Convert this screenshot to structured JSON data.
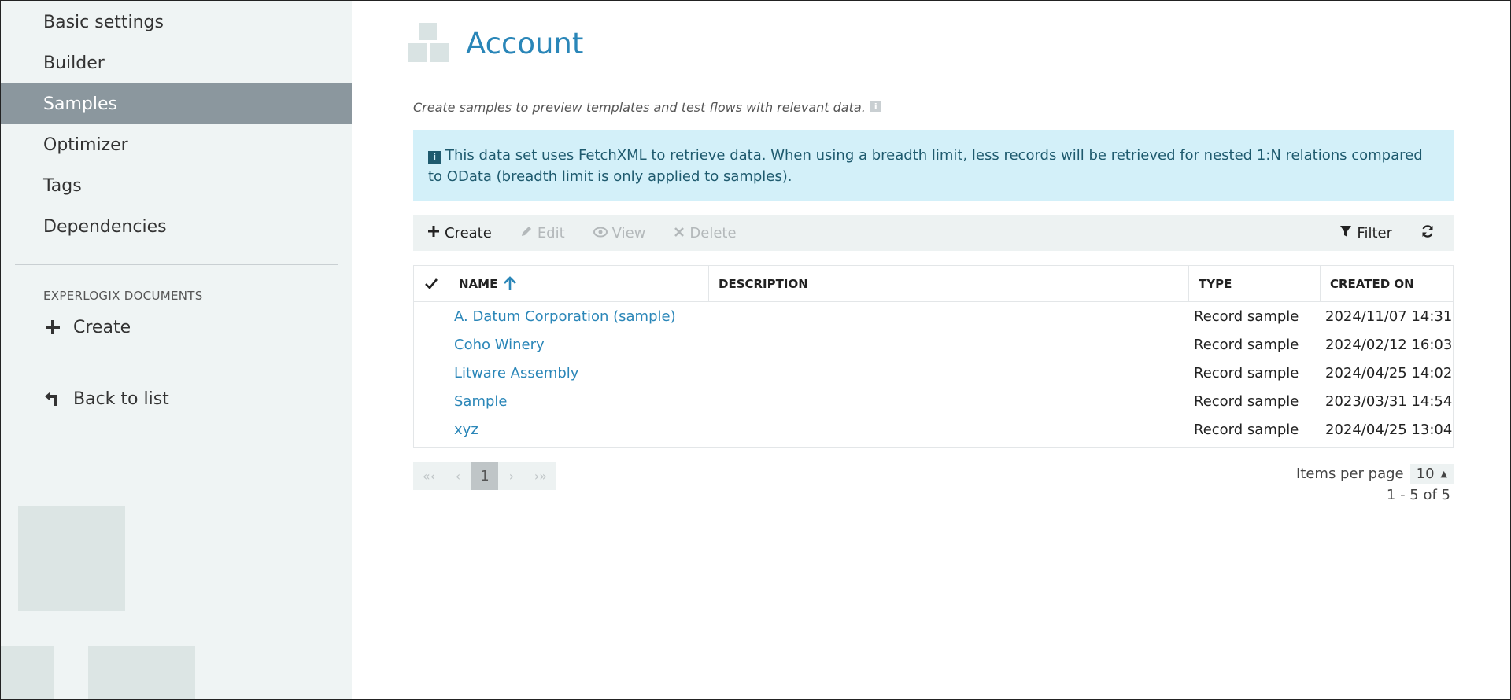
{
  "sidebar": {
    "items": [
      {
        "label": "Basic settings"
      },
      {
        "label": "Builder"
      },
      {
        "label": "Samples"
      },
      {
        "label": "Optimizer"
      },
      {
        "label": "Tags"
      },
      {
        "label": "Dependencies"
      }
    ],
    "section_title": "EXPERLOGIX DOCUMENTS",
    "create_label": "Create",
    "back_label": "Back to list"
  },
  "header": {
    "title": "Account",
    "subtitle": "Create samples to preview templates and test flows with relevant data.",
    "info_glyph": "i"
  },
  "alert": {
    "icon_glyph": "i",
    "text": "This data set uses FetchXML to retrieve data. When using a breadth limit, less records will be retrieved for nested 1:N relations compared to OData (breadth limit is only applied to samples)."
  },
  "toolbar": {
    "create": "Create",
    "edit": "Edit",
    "view": "View",
    "delete": "Delete",
    "filter": "Filter"
  },
  "grid": {
    "columns": {
      "name": "NAME",
      "description": "DESCRIPTION",
      "type": "TYPE",
      "created": "CREATED ON"
    },
    "rows": [
      {
        "name": "A. Datum Corporation (sample)",
        "description": "",
        "type": "Record sample",
        "created": "2024/11/07 14:31"
      },
      {
        "name": "Coho Winery",
        "description": "",
        "type": "Record sample",
        "created": "2024/02/12 16:03"
      },
      {
        "name": "Litware Assembly",
        "description": "",
        "type": "Record sample",
        "created": "2024/04/25 14:02"
      },
      {
        "name": "Sample",
        "description": "",
        "type": "Record sample",
        "created": "2023/03/31 14:54"
      },
      {
        "name": "xyz",
        "description": "",
        "type": "Record sample",
        "created": "2024/04/25 13:04"
      }
    ]
  },
  "pager": {
    "first": "«‹",
    "prev": "‹",
    "current": "1",
    "next": "›",
    "last": "›»",
    "items_per_page_label": "Items per page",
    "items_per_page_value": "10",
    "range": "1 - 5 of 5"
  },
  "colors": {
    "accent": "#2a86b8",
    "sidebar_active": "#8b979e",
    "sidebar_bg": "#eff4f4",
    "alert_bg": "#d3f0f9"
  }
}
